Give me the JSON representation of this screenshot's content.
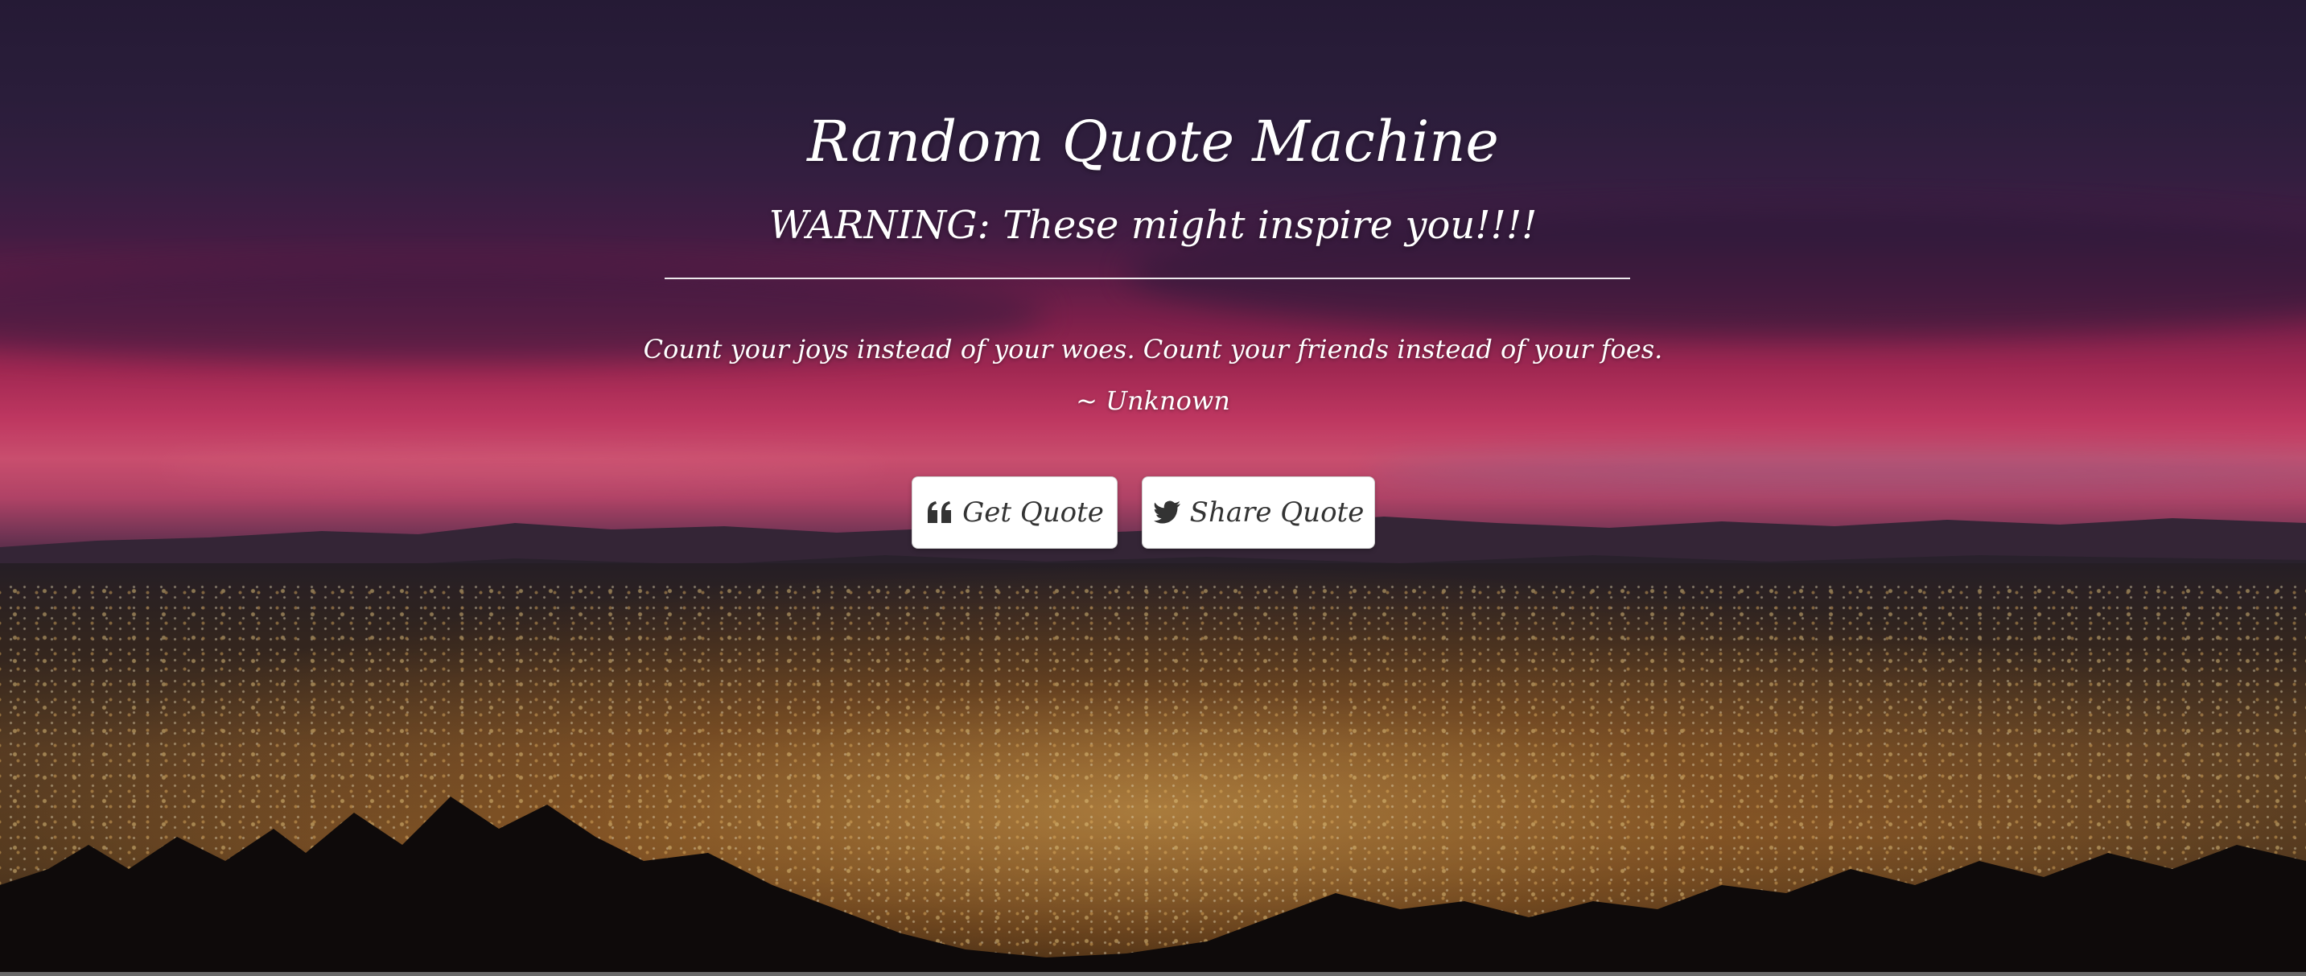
{
  "header": {
    "title": "Random Quote Machine",
    "subtitle": "WARNING: These might inspire you!!!!"
  },
  "quote": {
    "text": "Count your joys instead of your woes. Count your friends instead of your foes.",
    "author": "~ Unknown"
  },
  "actions": {
    "get_quote_label": "Get Quote",
    "get_quote_icon": "quote-left-icon",
    "share_quote_label": "Share Quote",
    "share_quote_icon": "twitter-icon"
  },
  "colors": {
    "text": "#ffffff",
    "button_bg": "#ffffff",
    "button_text": "#333333",
    "sky_pink": "#d83e6c",
    "sky_purple": "#2f2040"
  }
}
